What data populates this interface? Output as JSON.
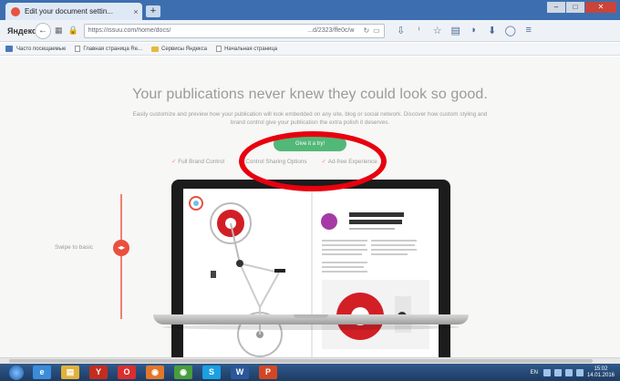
{
  "browser": {
    "tab_title": "Edit your document settin...",
    "tab_close": "×",
    "new_tab": "+",
    "window_controls": [
      "–",
      "□",
      "✕"
    ],
    "brand": "Яндекс",
    "url": "https://issuu.com/home/docs/",
    "url_tail": "...d/2323/ffe0c/w",
    "toolbar_icons": [
      "download-icon",
      "info-icon",
      "star-icon",
      "bookmark-icon",
      "pocket-icon",
      "arrow-icon",
      "chat-icon",
      "menu-icon"
    ]
  },
  "bookmarks": [
    {
      "label": "Часто посещаемые",
      "icon": "page"
    },
    {
      "label": "Главная страница Re...",
      "icon": "page"
    },
    {
      "label": "Сервисы Яндекса",
      "icon": "folder"
    },
    {
      "label": "Начальная страница",
      "icon": "page"
    }
  ],
  "hero": {
    "headline": "Your publications never knew they could look so good.",
    "subtext": "Easily customize and preview how your publication will look embedded on any site, blog or social network. Discover how custom styling and brand control give your publication the extra polish it deserves.",
    "cta_label": "Give it a try!",
    "features": [
      "Full Brand Control",
      "Control Sharing Options",
      "Ad-free Experience"
    ],
    "swipe_label": "Swipe to basic"
  },
  "colors": {
    "accent": "#52b877",
    "brand_red": "#e9503f",
    "highlight": "#e8000f"
  },
  "taskbar": {
    "apps": [
      {
        "name": "ie",
        "color": "#3b8cd8",
        "glyph": "e"
      },
      {
        "name": "explorer",
        "color": "#e1b13b",
        "glyph": "▤"
      },
      {
        "name": "yandex",
        "color": "#c22d20",
        "glyph": "Y"
      },
      {
        "name": "opera",
        "color": "#d82f2f",
        "glyph": "O"
      },
      {
        "name": "firefox",
        "color": "#e2762c",
        "glyph": "◉"
      },
      {
        "name": "chrome",
        "color": "#4a9d3c",
        "glyph": "◉"
      },
      {
        "name": "skype",
        "color": "#1ba0e2",
        "glyph": "S"
      },
      {
        "name": "word",
        "color": "#2b579a",
        "glyph": "W"
      },
      {
        "name": "powerpoint",
        "color": "#d24726",
        "glyph": "P"
      }
    ],
    "lang": "EN",
    "time": "15:02",
    "date": "14.01.2016"
  }
}
